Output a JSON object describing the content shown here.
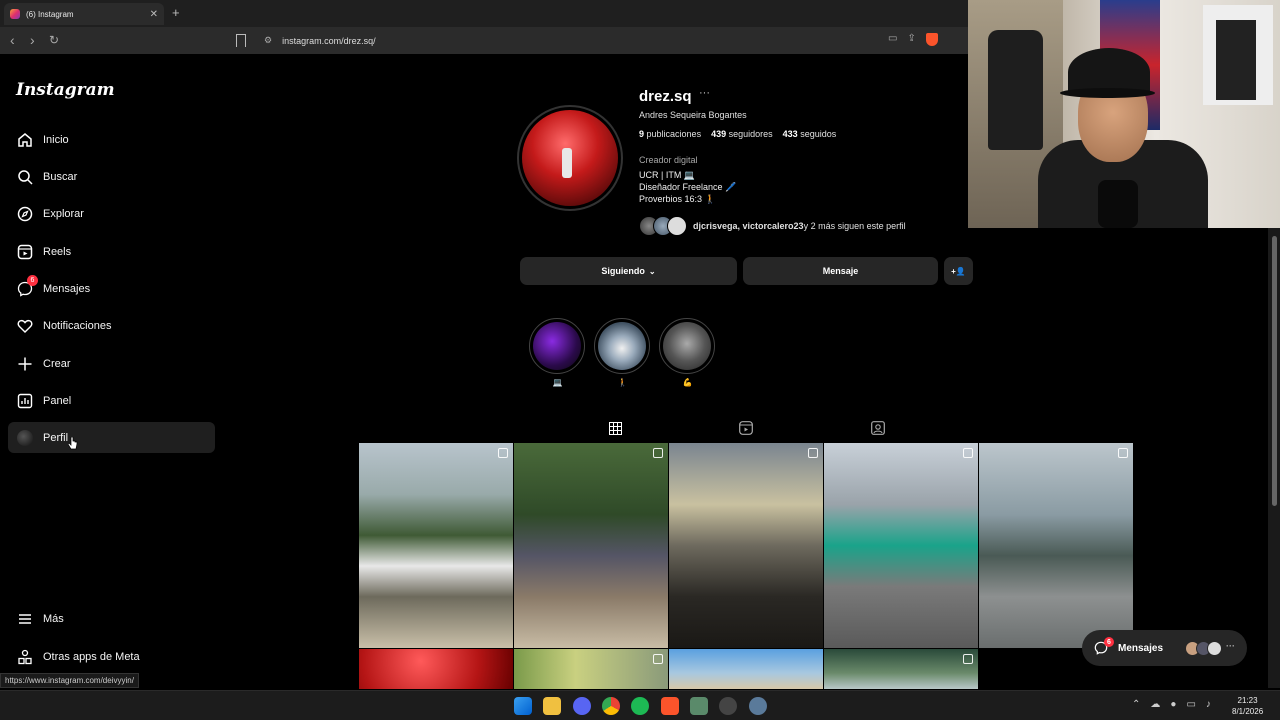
{
  "browser": {
    "tab_title": "(6) Instagram",
    "url": "instagram.com/drez.sq/",
    "status_url": "https://www.instagram.com/deivyyin/"
  },
  "sidebar": {
    "logo": "Instagram",
    "items": [
      {
        "label": "Inicio",
        "icon": "home-icon"
      },
      {
        "label": "Buscar",
        "icon": "search-icon"
      },
      {
        "label": "Explorar",
        "icon": "compass-icon"
      },
      {
        "label": "Reels",
        "icon": "reels-icon"
      },
      {
        "label": "Mensajes",
        "icon": "messenger-icon",
        "badge": "6"
      },
      {
        "label": "Notificaciones",
        "icon": "heart-icon"
      },
      {
        "label": "Crear",
        "icon": "plus-icon"
      },
      {
        "label": "Panel",
        "icon": "chart-icon"
      },
      {
        "label": "Perfil",
        "icon": "avatar"
      }
    ],
    "bottom": [
      {
        "label": "Más",
        "icon": "menu-icon"
      },
      {
        "label": "Otras apps de Meta",
        "icon": "meta-apps-icon"
      }
    ]
  },
  "profile": {
    "username": "drez.sq",
    "more": "···",
    "full_name": "Andres Sequeira Bogantes",
    "posts_count": "9",
    "posts_label": "publicaciones",
    "followers_count": "439",
    "followers_label": "seguidores",
    "following_count": "433",
    "following_label": "seguidos",
    "category": "Creador digital",
    "bio_lines": [
      "UCR | ITM 💻",
      "Diseñador Freelance 🖊️",
      "Proverbios 16:3 🚶"
    ],
    "followed_by_names": "djcrisvega, victorcalero23",
    "followed_by_rest": " y 2 más siguen este perfil"
  },
  "buttons": {
    "following": "Siguiendo",
    "message": "Mensaje",
    "add_user": "+👤"
  },
  "highlights": [
    {
      "label": "💻"
    },
    {
      "label": "🚶"
    },
    {
      "label": "💪"
    }
  ],
  "floating_messages": {
    "label": "Mensajes",
    "badge": "6"
  },
  "taskbar": {
    "time": "21:23",
    "date": "8/1/2026"
  }
}
